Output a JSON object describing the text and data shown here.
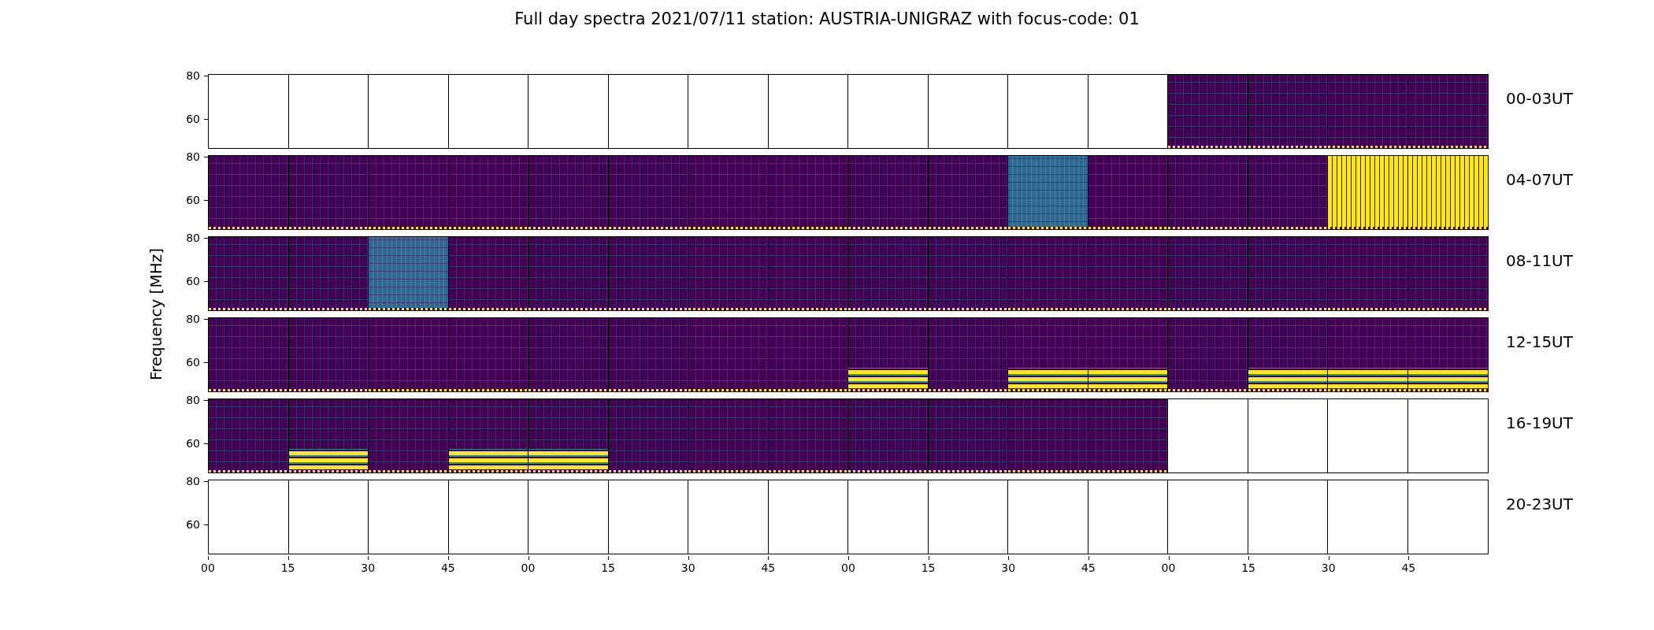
{
  "figure": {
    "title": "Full day spectra 2021/07/11 station: AUSTRIA-UNIGRAZ with focus-code: 01",
    "ylabel": "Frequency [MHz]",
    "xticks": [
      "00",
      "15",
      "30",
      "45",
      "00",
      "15",
      "30",
      "45",
      "00",
      "15",
      "30",
      "45",
      "00",
      "15",
      "30",
      "45"
    ],
    "rows": [
      {
        "label": "00-03UT",
        "yticks": [
          "80",
          "60"
        ],
        "cells": [
          {
            "kind": "empty"
          },
          {
            "kind": "empty"
          },
          {
            "kind": "empty"
          },
          {
            "kind": "empty"
          },
          {
            "kind": "empty"
          },
          {
            "kind": "empty"
          },
          {
            "kind": "empty"
          },
          {
            "kind": "empty"
          },
          {
            "kind": "empty"
          },
          {
            "kind": "empty"
          },
          {
            "kind": "empty"
          },
          {
            "kind": "empty"
          },
          {
            "kind": "spectrum"
          },
          {
            "kind": "spectrum"
          },
          {
            "kind": "spectrum"
          },
          {
            "kind": "spectrum"
          }
        ]
      },
      {
        "label": "04-07UT",
        "yticks": [
          "80",
          "60"
        ],
        "cells": [
          {
            "kind": "spectrum"
          },
          {
            "kind": "spectrum"
          },
          {
            "kind": "spectrum"
          },
          {
            "kind": "spectrum"
          },
          {
            "kind": "spectrum"
          },
          {
            "kind": "spectrum"
          },
          {
            "kind": "spectrum"
          },
          {
            "kind": "spectrum"
          },
          {
            "kind": "spectrum"
          },
          {
            "kind": "spectrum"
          },
          {
            "kind": "bright"
          },
          {
            "kind": "spectrum"
          },
          {
            "kind": "spectrum"
          },
          {
            "kind": "spectrum"
          },
          {
            "kind": "saturated"
          },
          {
            "kind": "saturated"
          }
        ]
      },
      {
        "label": "08-11UT",
        "yticks": [
          "80",
          "60"
        ],
        "cells": [
          {
            "kind": "spectrum"
          },
          {
            "kind": "spectrum"
          },
          {
            "kind": "bright"
          },
          {
            "kind": "spectrum"
          },
          {
            "kind": "spectrum"
          },
          {
            "kind": "spectrum"
          },
          {
            "kind": "spectrum"
          },
          {
            "kind": "spectrum"
          },
          {
            "kind": "spectrum"
          },
          {
            "kind": "spectrum"
          },
          {
            "kind": "spectrum"
          },
          {
            "kind": "spectrum"
          },
          {
            "kind": "spectrum"
          },
          {
            "kind": "spectrum"
          },
          {
            "kind": "spectrum"
          },
          {
            "kind": "spectrum"
          }
        ]
      },
      {
        "label": "12-15UT",
        "yticks": [
          "80",
          "60"
        ],
        "cells": [
          {
            "kind": "spectrum"
          },
          {
            "kind": "spectrum"
          },
          {
            "kind": "spectrum"
          },
          {
            "kind": "spectrum"
          },
          {
            "kind": "spectrum"
          },
          {
            "kind": "spectrum"
          },
          {
            "kind": "spectrum"
          },
          {
            "kind": "spectrum"
          },
          {
            "kind": "band"
          },
          {
            "kind": "spectrum"
          },
          {
            "kind": "band"
          },
          {
            "kind": "band"
          },
          {
            "kind": "spectrum"
          },
          {
            "kind": "band"
          },
          {
            "kind": "band"
          },
          {
            "kind": "band"
          }
        ]
      },
      {
        "label": "16-19UT",
        "yticks": [
          "80",
          "60"
        ],
        "cells": [
          {
            "kind": "spectrum"
          },
          {
            "kind": "band"
          },
          {
            "kind": "spectrum"
          },
          {
            "kind": "band"
          },
          {
            "kind": "band"
          },
          {
            "kind": "spectrum"
          },
          {
            "kind": "spectrum"
          },
          {
            "kind": "spectrum"
          },
          {
            "kind": "spectrum"
          },
          {
            "kind": "spectrum"
          },
          {
            "kind": "spectrum"
          },
          {
            "kind": "spectrum"
          },
          {
            "kind": "empty"
          },
          {
            "kind": "empty"
          },
          {
            "kind": "empty"
          },
          {
            "kind": "empty"
          }
        ]
      },
      {
        "label": "20-23UT",
        "yticks": [
          "80",
          "60"
        ],
        "cells": [
          {
            "kind": "empty"
          },
          {
            "kind": "empty"
          },
          {
            "kind": "empty"
          },
          {
            "kind": "empty"
          },
          {
            "kind": "empty"
          },
          {
            "kind": "empty"
          },
          {
            "kind": "empty"
          },
          {
            "kind": "empty"
          },
          {
            "kind": "empty"
          },
          {
            "kind": "empty"
          },
          {
            "kind": "empty"
          },
          {
            "kind": "empty"
          },
          {
            "kind": "empty"
          },
          {
            "kind": "empty"
          },
          {
            "kind": "empty"
          },
          {
            "kind": "empty"
          }
        ]
      }
    ]
  }
}
